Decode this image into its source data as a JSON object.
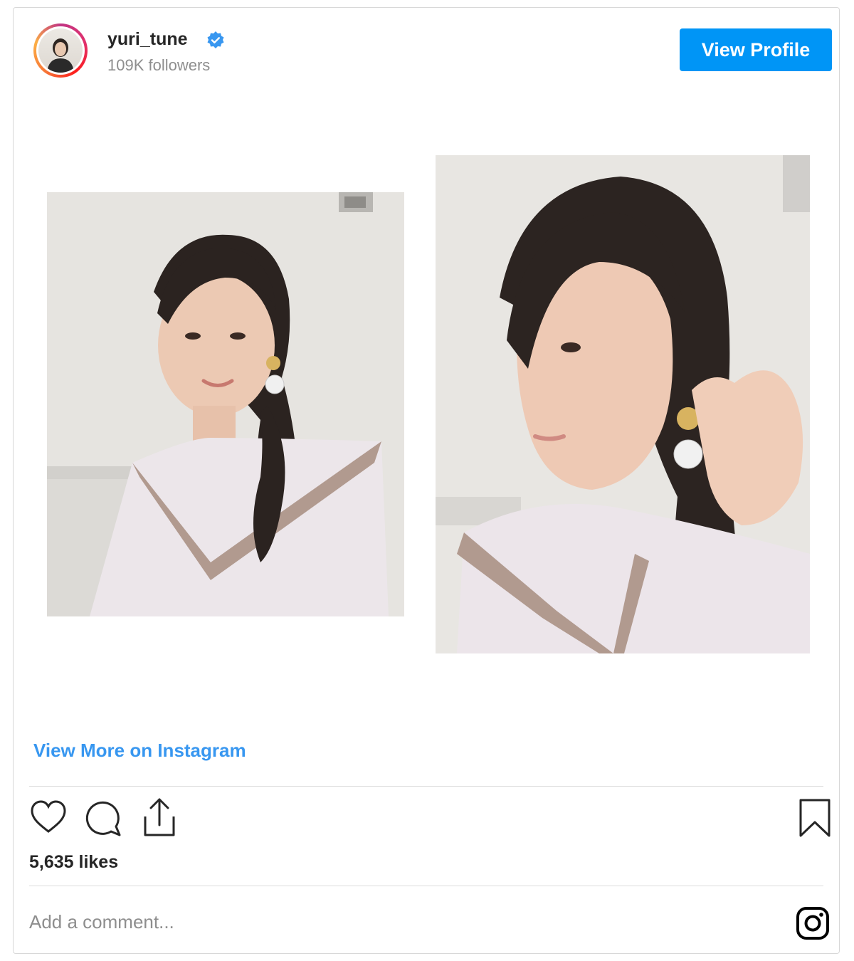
{
  "header": {
    "username": "yuri_tune",
    "followers": "109K followers",
    "view_profile_label": "View Profile"
  },
  "post": {
    "view_more_label": "View More on Instagram",
    "likes": "5,635 likes",
    "comment_placeholder": "Add a comment..."
  },
  "icons": [
    "verified-badge-icon",
    "heart-icon",
    "comment-icon",
    "share-icon",
    "bookmark-icon",
    "instagram-icon"
  ],
  "colors": {
    "accent": "#0095f6",
    "link": "#3897f0",
    "text": "#262626",
    "muted": "#8e8e8e"
  }
}
